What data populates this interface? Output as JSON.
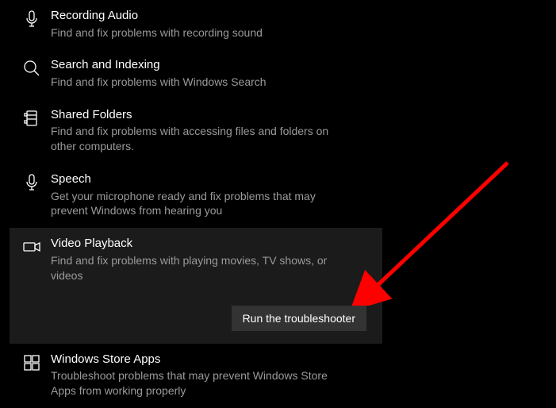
{
  "items": [
    {
      "icon": "microphone-icon",
      "title": "Recording Audio",
      "desc": "Find and fix problems with recording sound"
    },
    {
      "icon": "search-icon",
      "title": "Search and Indexing",
      "desc": "Find and fix problems with Windows Search"
    },
    {
      "icon": "folder-icon",
      "title": "Shared Folders",
      "desc": "Find and fix problems with accessing files and folders on other computers."
    },
    {
      "icon": "microphone-icon",
      "title": "Speech",
      "desc": "Get your microphone ready and fix problems that may prevent Windows from hearing you"
    },
    {
      "icon": "video-icon",
      "title": "Video Playback",
      "desc": "Find and fix problems with playing movies, TV shows, or videos",
      "selected": true,
      "action": "Run the troubleshooter"
    },
    {
      "icon": "apps-icon",
      "title": "Windows Store Apps",
      "desc": "Troubleshoot problems that may prevent Windows Store Apps from working properly"
    }
  ]
}
